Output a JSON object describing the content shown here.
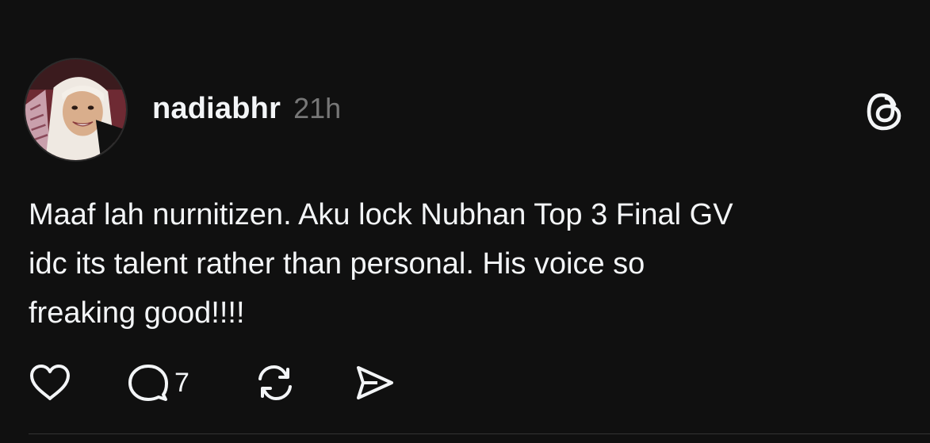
{
  "post": {
    "username": "nadiabhr",
    "timestamp": "21h",
    "text_lines": [
      "Maaf lah nurnitizen. Aku lock Nubhan Top 3 Final GV",
      "idc its talent rather than personal. His voice so",
      "freaking good!!!!"
    ],
    "comment_count": "7"
  },
  "icons": {
    "brand": "threads-icon",
    "like": "heart-icon",
    "comment": "comment-bubble-icon",
    "repost": "repost-icon",
    "share": "send-icon"
  },
  "colors": {
    "background": "#101010",
    "text_primary": "#f3f5f7",
    "text_secondary": "#777777"
  }
}
